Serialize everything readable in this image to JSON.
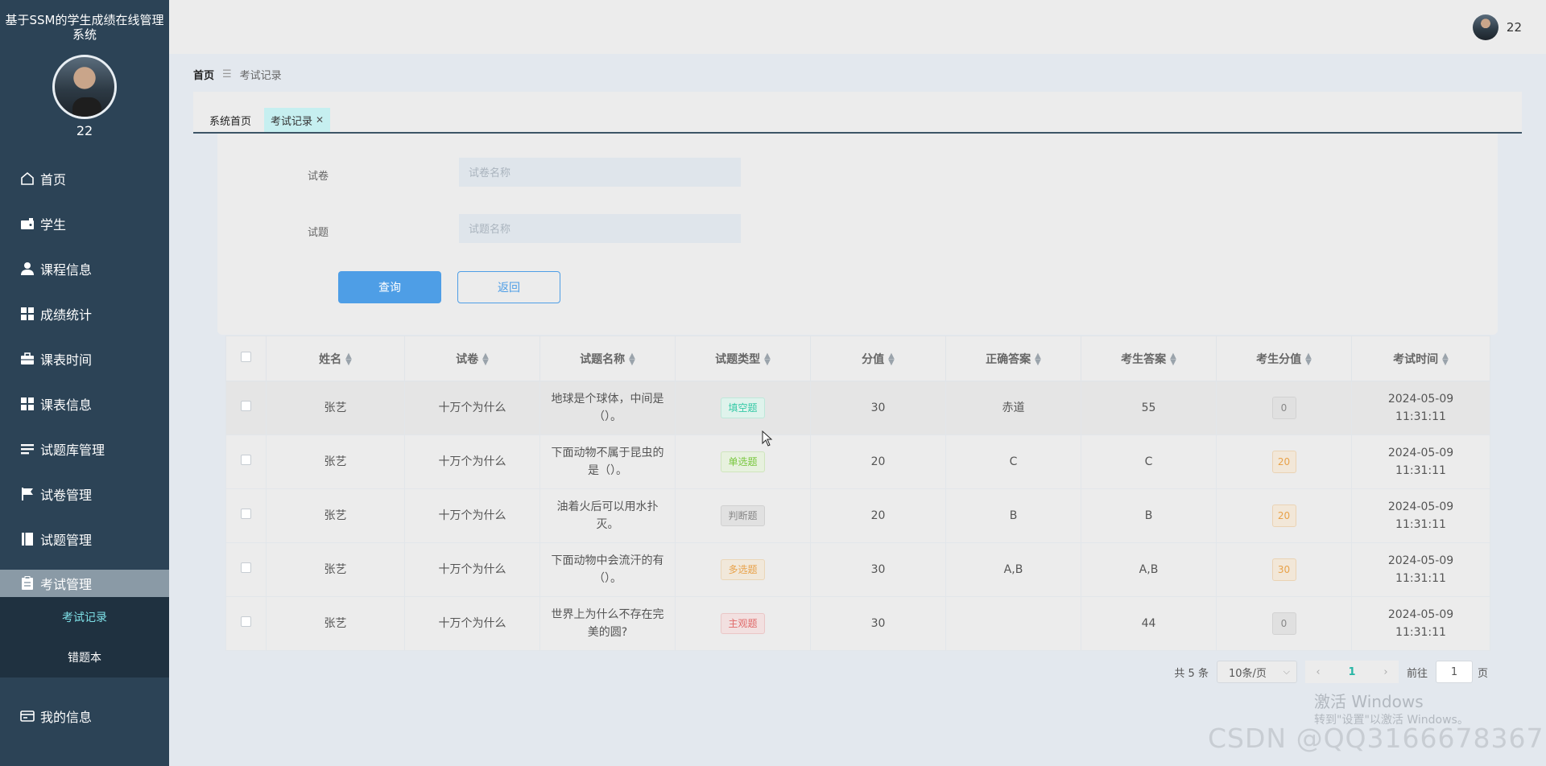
{
  "sidebar": {
    "title": "基于SSM的学生成绩在线管理系统",
    "user": "22",
    "items": [
      {
        "label": "首页",
        "icon": "home-icon"
      },
      {
        "label": "学生",
        "icon": "wallet-icon"
      },
      {
        "label": "课程信息",
        "icon": "user-icon"
      },
      {
        "label": "成绩统计",
        "icon": "grid-icon"
      },
      {
        "label": "课表时间",
        "icon": "briefcase-icon"
      },
      {
        "label": "课表信息",
        "icon": "grid-icon"
      },
      {
        "label": "试题库管理",
        "icon": "list-icon"
      },
      {
        "label": "试卷管理",
        "icon": "flag-icon"
      },
      {
        "label": "试题管理",
        "icon": "book-icon"
      },
      {
        "label": "考试管理",
        "icon": "clipboard-icon"
      }
    ],
    "submenu": [
      {
        "label": "考试记录"
      },
      {
        "label": "错题本"
      }
    ],
    "myinfo": {
      "label": "我的信息",
      "icon": "card-icon"
    }
  },
  "header": {
    "user": "22"
  },
  "breadcrumb": {
    "home": "首页",
    "current": "考试记录"
  },
  "tabs": [
    {
      "label": "系统首页"
    },
    {
      "label": "考试记录",
      "close": "✕"
    }
  ],
  "search": {
    "paper_label": "试卷",
    "paper_placeholder": "试卷名称",
    "question_label": "试题",
    "question_placeholder": "试题名称",
    "query_button": "查询",
    "back_button": "返回"
  },
  "table": {
    "headers": [
      "姓名",
      "试卷",
      "试题名称",
      "试题类型",
      "分值",
      "正确答案",
      "考生答案",
      "考生分值",
      "考试时间"
    ],
    "rows": [
      {
        "name": "张艺",
        "paper": "十万个为什么",
        "question": "地球是个球体，中间是（）。",
        "type": "填空题",
        "type_color": "green",
        "score": "30",
        "correct": "赤道",
        "answer": "55",
        "got": "0",
        "got_color": "gray",
        "time": "2024-05-09 11:31:11"
      },
      {
        "name": "张艺",
        "paper": "十万个为什么",
        "question": "下面动物不属于昆虫的是（）。",
        "type": "单选题",
        "type_color": "lime",
        "score": "20",
        "correct": "C",
        "answer": "C",
        "got": "20",
        "got_color": "orange",
        "time": "2024-05-09 11:31:11"
      },
      {
        "name": "张艺",
        "paper": "十万个为什么",
        "question": "油着火后可以用水扑灭。",
        "type": "判断题",
        "type_color": "gray",
        "score": "20",
        "correct": "B",
        "answer": "B",
        "got": "20",
        "got_color": "orange",
        "time": "2024-05-09 11:31:11"
      },
      {
        "name": "张艺",
        "paper": "十万个为什么",
        "question": "下面动物中会流汗的有（）。",
        "type": "多选题",
        "type_color": "orange",
        "score": "30",
        "correct": "A,B",
        "answer": "A,B",
        "got": "30",
        "got_color": "orange",
        "time": "2024-05-09 11:31:11"
      },
      {
        "name": "张艺",
        "paper": "十万个为什么",
        "question": "世界上为什么不存在完美的圆?",
        "type": "主观题",
        "type_color": "red",
        "score": "30",
        "correct": "",
        "answer": "44",
        "got": "0",
        "got_color": "gray",
        "time": "2024-05-09 11:31:11"
      }
    ]
  },
  "pagination": {
    "total": "共 5 条",
    "page_size": "10条/页",
    "current_page": "1",
    "goto_label": "前往",
    "goto_value": "1",
    "page_unit": "页"
  },
  "watermark": {
    "windows_line1": "激活 Windows",
    "windows_line2": "转到\"设置\"以激活 Windows。",
    "csdn": "CSDN @QQ3166678367"
  }
}
